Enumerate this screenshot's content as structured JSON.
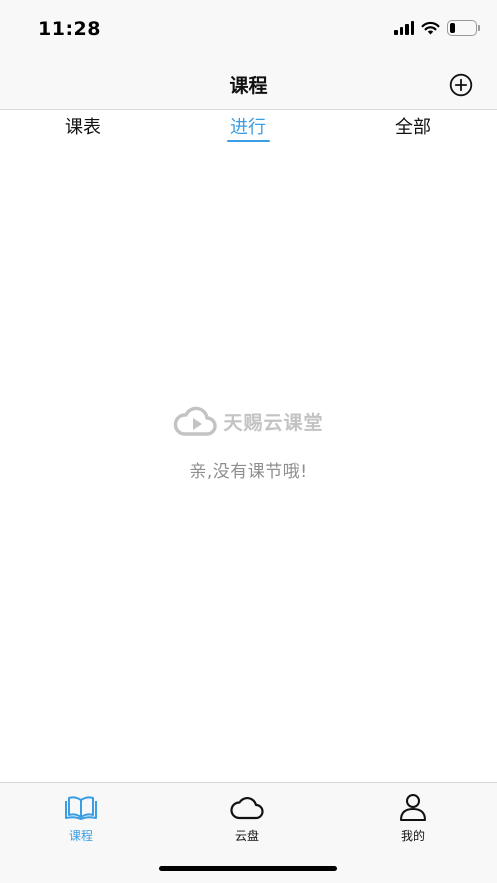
{
  "status_bar": {
    "time": "11:28",
    "battery_level": 0.22
  },
  "nav": {
    "title": "课程",
    "add_icon": "plus-circle-icon"
  },
  "tabs": [
    {
      "label": "课表",
      "active": false
    },
    {
      "label": "进行",
      "active": true
    },
    {
      "label": "全部",
      "active": false
    }
  ],
  "empty_state": {
    "logo_text": "天赐云课堂",
    "logo_icon": "cloud-play-icon",
    "message": "亲,没有课节哦!"
  },
  "tab_bar": {
    "items": [
      {
        "label": "课程",
        "icon": "book-icon",
        "active": true
      },
      {
        "label": "云盘",
        "icon": "cloud-icon",
        "active": false
      },
      {
        "label": "我的",
        "icon": "person-icon",
        "active": false
      }
    ]
  },
  "colors": {
    "accent": "#3a9ee4",
    "muted": "#8e8e8e",
    "logo": "#c3c3c3"
  }
}
